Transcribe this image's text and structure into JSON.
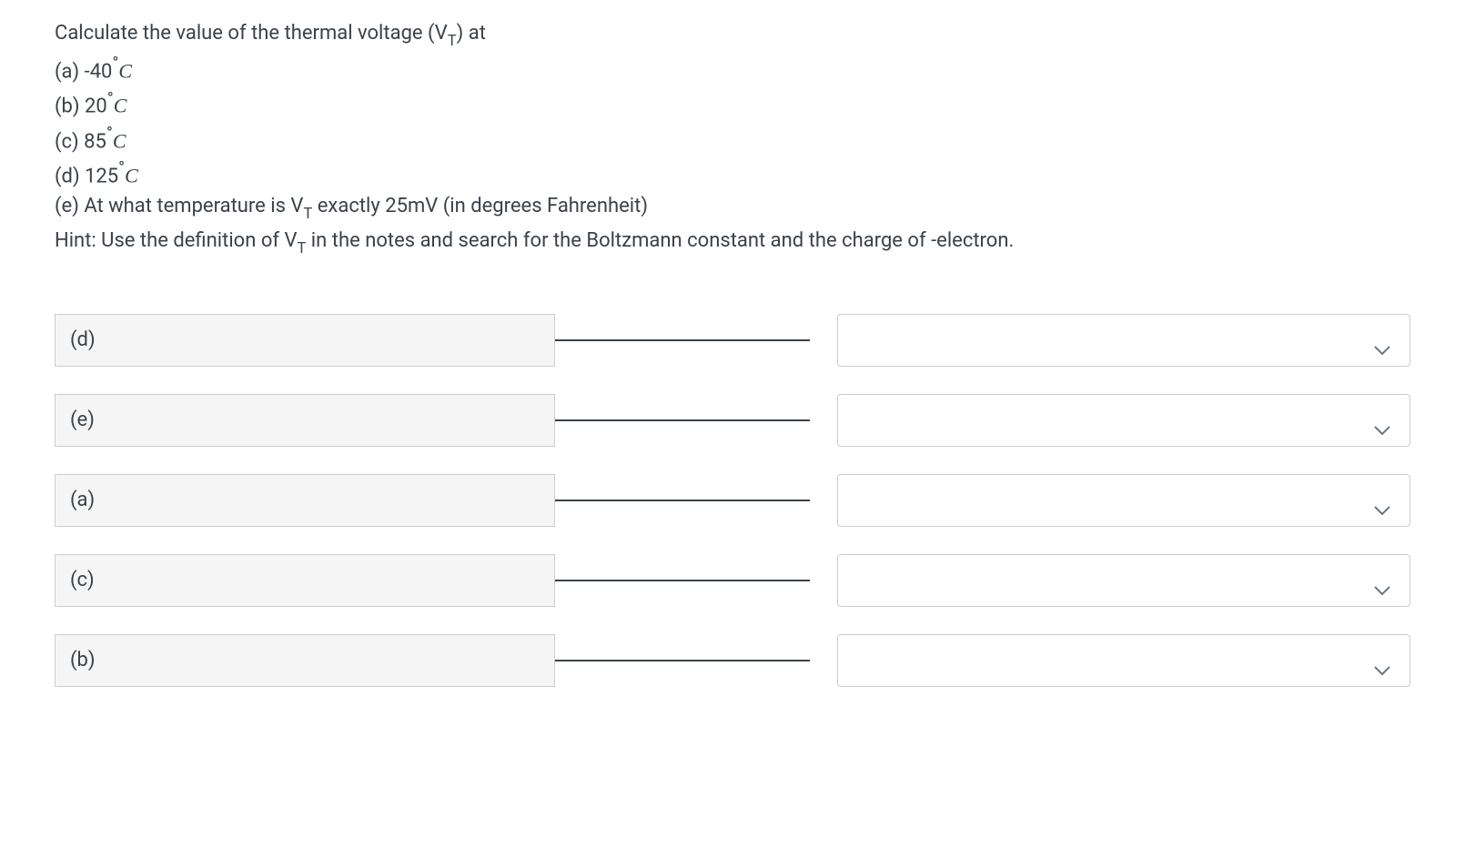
{
  "question": {
    "intro": "Calculate the value of the thermal voltage (V",
    "intro_sub": "T",
    "intro_end": ") at",
    "part_a_label": "(a) -40",
    "part_b_label": "(b) 20",
    "part_c_label": "(c) 85",
    "part_d_label": "(d) 125",
    "degree_symbol": "°",
    "unit_c": "C",
    "part_e": "(e) At what temperature is V",
    "part_e_sub": "T",
    "part_e_end": " exactly 25mV (in degrees Fahrenheit)",
    "hint_start": "Hint: Use the definition of V",
    "hint_sub": "T",
    "hint_end": " in the notes and search for the Boltzmann constant and the charge of -electron."
  },
  "matching": {
    "rows": [
      {
        "label": "(d)"
      },
      {
        "label": "(e)"
      },
      {
        "label": "(a)"
      },
      {
        "label": "(c)"
      },
      {
        "label": "(b)"
      }
    ]
  }
}
